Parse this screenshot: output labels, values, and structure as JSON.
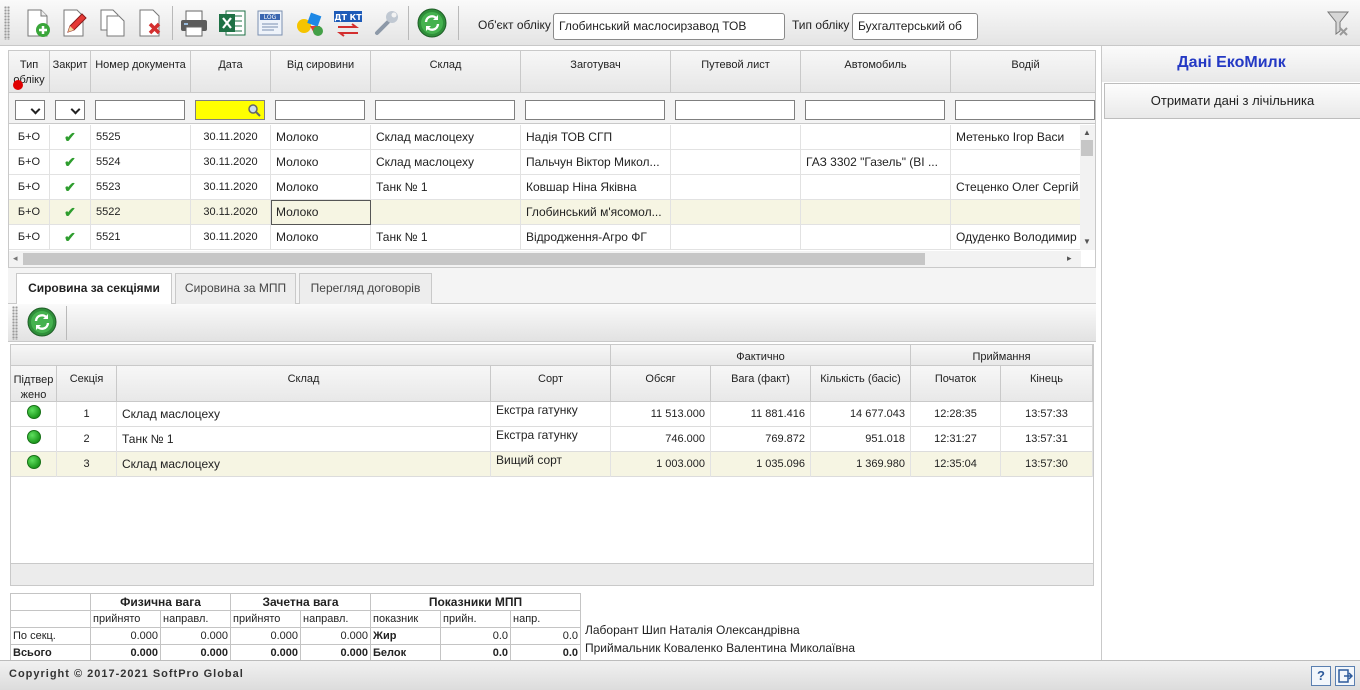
{
  "toolbar": {
    "buttons": [
      "add-document",
      "edit-document",
      "copy-document",
      "delete-document",
      "print",
      "export-excel",
      "log",
      "analytics",
      "debit-credit",
      "settings",
      "refresh"
    ],
    "org_label": "Об'єкт обліку",
    "org_value": "Глобинський маслосирзавод ТОВ",
    "account_label": "Тип обліку",
    "account_value": "Бухгалтерський об"
  },
  "documents": {
    "columns": [
      "Тип обліку",
      "Закрит",
      "Номер документа",
      "Дата",
      "Від сировини",
      "Склад",
      "Заготувач",
      "Путевой лист",
      "Автомобиль",
      "Водій"
    ],
    "rows": [
      {
        "type": "Б+О",
        "closed": "✔",
        "number": "5525",
        "date": "30.11.2020",
        "raw": "Молоко",
        "warehouse": "Склад маслоцеху",
        "supplier": "Надія ТОВ СГП",
        "waybill": "",
        "car": "",
        "driver": "Метенько Ігор Васи"
      },
      {
        "type": "Б+О",
        "closed": "✔",
        "number": "5524",
        "date": "30.11.2020",
        "raw": "Молоко",
        "warehouse": "Склад маслоцеху",
        "supplier": "Пальчун Віктор Микол...",
        "waybill": "",
        "car": "ГАЗ 3302 \"Газель\" (ВІ ...",
        "driver": ""
      },
      {
        "type": "Б+О",
        "closed": "✔",
        "number": "5523",
        "date": "30.11.2020",
        "raw": "Молоко",
        "warehouse": "Танк № 1",
        "supplier": "Ковшар Ніна Яківна",
        "waybill": "",
        "car": "",
        "driver": "Стеценко Олег Сергій"
      },
      {
        "type": "Б+О",
        "closed": "✔",
        "number": "5522",
        "date": "30.11.2020",
        "raw": "Молоко",
        "warehouse": "",
        "supplier": "Глобинський м'ясомол...",
        "waybill": "",
        "car": "",
        "driver": ""
      },
      {
        "type": "Б+О",
        "closed": "✔",
        "number": "5521",
        "date": "30.11.2020",
        "raw": "Молоко",
        "warehouse": "Танк № 1",
        "supplier": "Відродження-Агро ФГ",
        "waybill": "",
        "car": "",
        "driver": "Одуденко Володимир"
      }
    ]
  },
  "right_panel": {
    "title": "Дані ЕкоМилк",
    "button": "Отримати дані з лічільника"
  },
  "tabs": [
    "Сировина за секціями",
    "Сировина за МПП",
    "Перегляд договорів"
  ],
  "sections": {
    "group_headers": {
      "actual": "Фактично",
      "receiving": "Приймання"
    },
    "columns": [
      "Підтвер жено",
      "Секція",
      "Склад",
      "Сорт",
      "Обсяг",
      "Вага (факт)",
      "Кількість (басіс)",
      "Початок",
      "Кінець"
    ],
    "rows": [
      {
        "section": "1",
        "warehouse": "Склад маслоцеху",
        "grade": "Екстра гатунку",
        "volume": "11 513.000",
        "weight": "11 881.416",
        "qty": "14 677.043",
        "start": "12:28:35",
        "end": "13:57:33"
      },
      {
        "section": "2",
        "warehouse": "Танк № 1",
        "grade": "Екстра гатунку",
        "volume": "746.000",
        "weight": "769.872",
        "qty": "951.018",
        "start": "12:31:27",
        "end": "13:57:31"
      },
      {
        "section": "3",
        "warehouse": "Склад маслоцеху",
        "grade": "Вищий сорт",
        "volume": "1 003.000",
        "weight": "1 035.096",
        "qty": "1 369.980",
        "start": "12:35:04",
        "end": "13:57:30"
      }
    ]
  },
  "summary": {
    "physical": "Физична вага",
    "credited": "Зачетна вага",
    "mpp": "Показники МПП",
    "accepted": "прийнято",
    "directed": "направл.",
    "indicator": "показник",
    "accepted_short": "прийн.",
    "directed_short": "напр.",
    "by_section": "По секц.",
    "total": "Всього",
    "row1": {
      "phys_acc": "0.000",
      "phys_dir": "0.000",
      "cred_acc": "0.000",
      "cred_dir": "0.000",
      "ind": "Жир",
      "mpp_acc": "0.0",
      "mpp_dir": "0.0"
    },
    "row2": {
      "phys_acc": "0.000",
      "phys_dir": "0.000",
      "cred_acc": "0.000",
      "cred_dir": "0.000",
      "ind": "Белок",
      "mpp_acc": "0.0",
      "mpp_dir": "0.0"
    },
    "lab": "Лаборант Шип Наталія Олександрівна",
    "receiver": "Приймальник Коваленко Валентина Миколаївна"
  },
  "status": {
    "copyright": "Copyright © 2017-2021 SoftPro Global",
    "help": "?"
  }
}
